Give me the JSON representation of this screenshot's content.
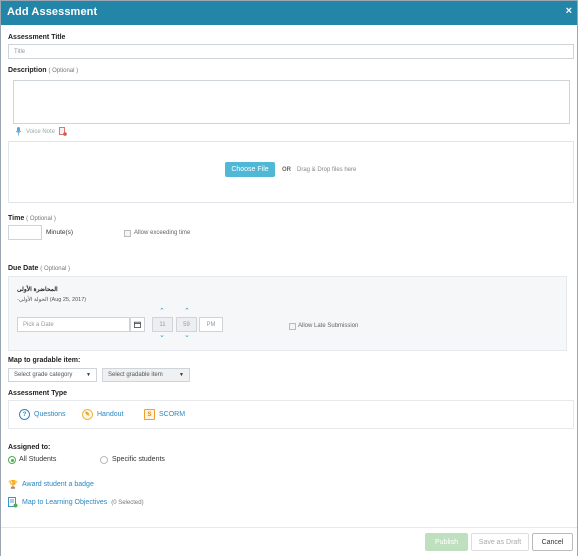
{
  "header": {
    "title": "Add Assessment",
    "close_symbol": "×"
  },
  "assessment_title": {
    "label": "Assessment Title",
    "placeholder": "Title"
  },
  "description": {
    "label": "Description",
    "optional": "( Optional )",
    "voice_note": "Voice Note"
  },
  "upload": {
    "choose_file": "Choose File",
    "or": "OR",
    "drag_drop": "Drag & Drop files here"
  },
  "time": {
    "label": "Time",
    "optional": "( Optional )",
    "value": "",
    "unit": "Minute(s)",
    "allow_exceeding": "Allow exceeding time"
  },
  "due_date": {
    "label": "Due Date",
    "optional": "( Optional )",
    "lecture_title": "المحاضرة الأولى",
    "lecture_subtitle": "-الحولة الأولى (Aug 25, 2017)",
    "date_placeholder": "Pick a Date",
    "hour": "11",
    "minute": "59",
    "ampm": "PM",
    "allow_late": "Allow Late Submission"
  },
  "gradable": {
    "label": "Map to gradable item:",
    "category_placeholder": "Select grade category",
    "item_placeholder": "Select gradable item"
  },
  "assessment_type": {
    "label": "Assessment Type",
    "types": [
      {
        "label": "Questions"
      },
      {
        "label": "Handout"
      },
      {
        "label": "SCORM"
      }
    ]
  },
  "assigned_to": {
    "label": "Assigned to:",
    "options": [
      {
        "label": "All Students",
        "selected": true
      },
      {
        "label": "Specific students",
        "selected": false
      }
    ]
  },
  "links": {
    "award_badge": "Award student a badge",
    "learning_objectives": "Map to Learning Objectives",
    "selected_count": "(0 Selected)"
  },
  "footer": {
    "publish": "Publish",
    "save_draft": "Save as Draft",
    "cancel": "Cancel"
  },
  "colors": {
    "header_bg": "#2385a7",
    "accent": "#4fb8d6",
    "link": "#2a87c2",
    "selected_radio": "#4caf50"
  }
}
